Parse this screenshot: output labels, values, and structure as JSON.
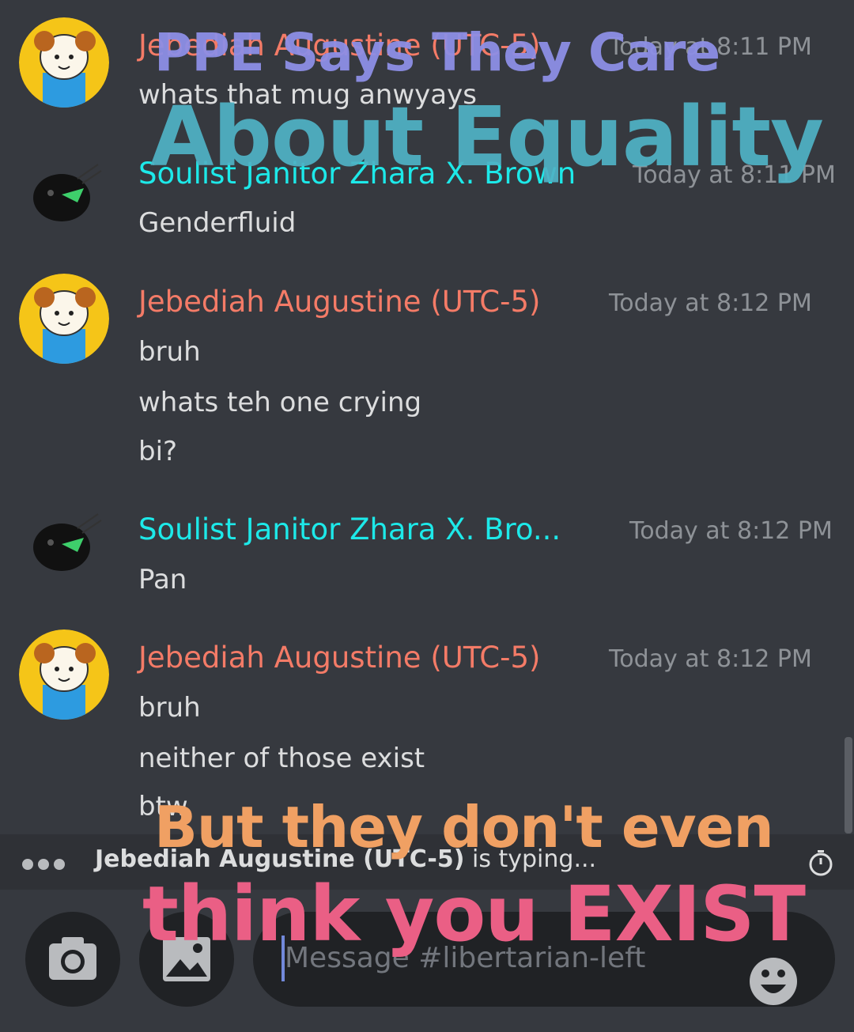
{
  "messages": [
    {
      "author": "Jebediah Augustine (UTC-5)",
      "timestamp": "Today at 8:11 PM",
      "lines": [
        "whats that mug anwyays"
      ]
    },
    {
      "author": "Soulist Janitor Zhara X. Brown",
      "timestamp": "Today at 8:11 PM",
      "lines": [
        "Genderfluid"
      ]
    },
    {
      "author": "Jebediah Augustine (UTC-5)",
      "timestamp": "Today at 8:12 PM",
      "lines": [
        "bruh",
        "whats teh one crying",
        "bi?"
      ]
    },
    {
      "author": "Soulist Janitor Zhara X. Bro...",
      "timestamp": "Today at 8:12 PM",
      "lines": [
        "Pan"
      ]
    },
    {
      "author": "Jebediah Augustine (UTC-5)",
      "timestamp": "Today at 8:12 PM",
      "lines": [
        "bruh",
        "neither of those exist",
        "btw"
      ]
    }
  ],
  "typing": {
    "user": "Jebediah Augustine (UTC-5)",
    "suffix": " is typing..."
  },
  "composer": {
    "placeholder": "Message #libertarian-left"
  },
  "icons": {
    "timer": "stopwatch-icon",
    "camera": "camera-icon",
    "gallery": "image-icon",
    "emoji": "emoji-icon",
    "typing": "typing-dots-icon"
  },
  "meme_overlay": {
    "top_line1": "PPE Says They Care",
    "top_line2": "About Equality",
    "bottom_line1": "But they don't even",
    "bottom_line2": "think you EXIST"
  },
  "colors": {
    "background": "#36393f",
    "jebediah_name": "#f47b67",
    "zhara_name": "#1de9e9"
  }
}
